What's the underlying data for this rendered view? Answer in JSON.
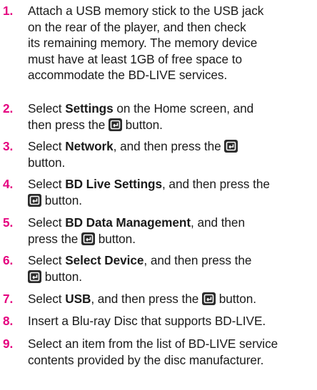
{
  "steps": [
    {
      "num": "1.",
      "lines": [
        "Attach a USB memory stick to the USB jack",
        "on the rear of the player, and then check",
        "its remaining memory. The memory device",
        "must have at least 1GB of free space to",
        "accommodate the BD-LIVE services."
      ]
    },
    {
      "num": "2.",
      "pre": "Select ",
      "bold": "Settings",
      "post1": " on the Home screen, and",
      "pre2": "then press the ",
      "post2": " button."
    },
    {
      "num": "3.",
      "pre": "Select ",
      "bold": "Network",
      "post1": ", and then press the ",
      "post2": "button."
    },
    {
      "num": "4.",
      "pre": "Select ",
      "bold": "BD Live Settings",
      "post1": ", and then press the",
      "post2": " button."
    },
    {
      "num": "5.",
      "pre": "Select ",
      "bold": "BD Data Management",
      "post1": ", and then",
      "pre2": "press the ",
      "post2": " button."
    },
    {
      "num": "6.",
      "pre": "Select ",
      "bold": "Select Device",
      "post1": ", and then press the",
      "post2": " button."
    },
    {
      "num": "7.",
      "pre": "Select ",
      "bold": "USB",
      "post1": ", and then press the ",
      "post2": " button."
    },
    {
      "num": "8.",
      "text": "Insert a Blu-ray Disc that supports BD-LIVE."
    },
    {
      "num": "9.",
      "lines": [
        "Select an item from the list of BD-LIVE service",
        "contents provided by the disc manufacturer."
      ]
    }
  ]
}
